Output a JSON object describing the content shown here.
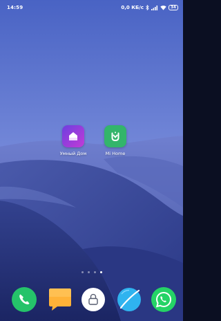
{
  "status_bar": {
    "time": "14:59",
    "network_speed": "0,0 КБ/с",
    "icons": [
      "bluetooth-icon",
      "signal-icon",
      "wifi-icon"
    ],
    "battery": "34"
  },
  "home": {
    "apps": [
      {
        "label": "Умный Дом",
        "icon": "smart-home-icon",
        "color": "#a23ad8"
      },
      {
        "label": "Mi Home",
        "icon": "mi-home-icon",
        "color": "#33b56b"
      }
    ],
    "pages": {
      "count": 4,
      "current": 4
    }
  },
  "dock": [
    {
      "icon": "phone-icon",
      "color": "#25c36a"
    },
    {
      "icon": "messages-icon",
      "color": "#ffb238"
    },
    {
      "icon": "security-icon",
      "color": "#ffffff"
    },
    {
      "icon": "browser-icon",
      "color": "#2fb3ef"
    },
    {
      "icon": "whatsapp-icon",
      "color": "#25d366"
    }
  ],
  "colors": {
    "sky_top": "#4e66c6",
    "sky_bottom": "#92a4e6",
    "dunes": "#2c3c8c"
  }
}
